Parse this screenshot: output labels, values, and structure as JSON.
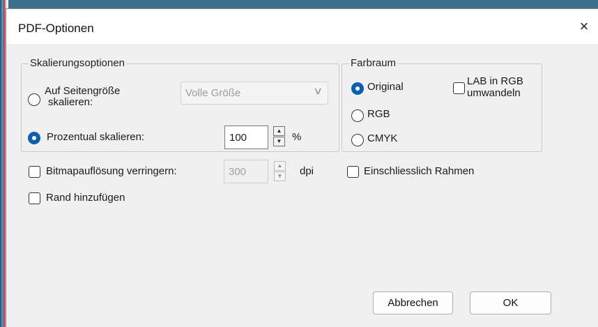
{
  "dialog": {
    "title": "PDF-Optionen",
    "close_glyph": "×"
  },
  "scaling": {
    "legend": "Skalierungsoptionen",
    "fit_label_line1": "Auf Seitengröße",
    "fit_label_line2": "skalieren:",
    "fit_selected": false,
    "size_combo_value": "Volle Größe",
    "percent_label": "Prozentual skalieren:",
    "percent_selected": true,
    "percent_value": "100",
    "percent_unit": "%"
  },
  "colorspace": {
    "legend": "Farbraum",
    "options": [
      {
        "label": "Original",
        "selected": true
      },
      {
        "label": "RGB",
        "selected": false
      },
      {
        "label": "CMYK",
        "selected": false
      }
    ],
    "lab_label_line1": "LAB in RGB",
    "lab_label_line2": "umwandeln",
    "lab_checked": false
  },
  "bitmap": {
    "label": "Bitmapauflösung verringern:",
    "checked": false,
    "value": "300",
    "unit": "dpi"
  },
  "border": {
    "label": "Rand hinzufügen",
    "checked": false
  },
  "frames": {
    "label": "Einschliesslich Rahmen",
    "checked": false
  },
  "buttons": {
    "cancel": "Abbrechen",
    "ok": "OK"
  },
  "colors": {
    "accent": "#0a5fb4",
    "dialog_bg": "#f0f0f0",
    "disabled_text": "#9b9b9b"
  }
}
